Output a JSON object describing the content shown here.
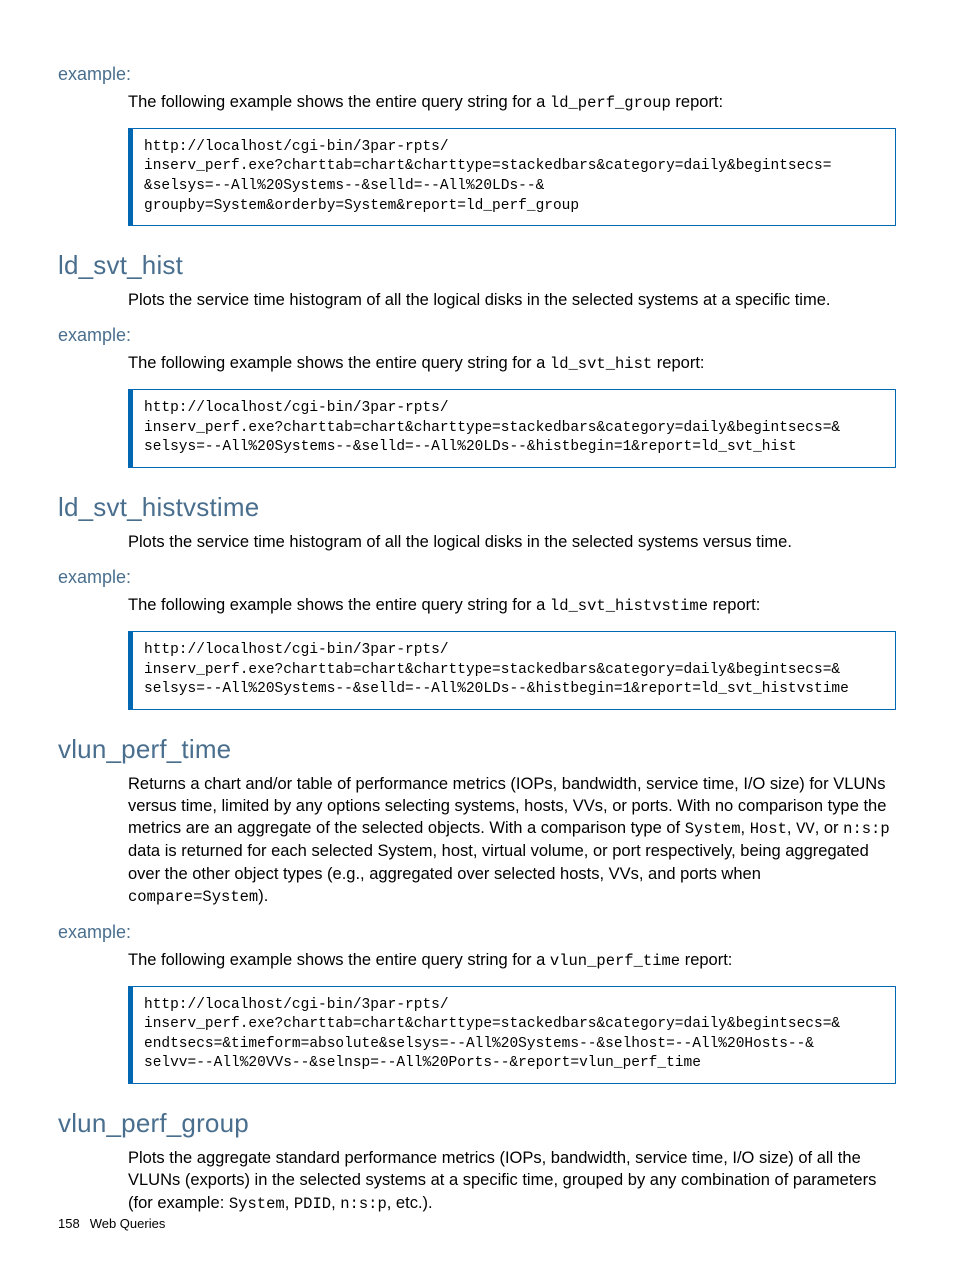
{
  "sections": [
    {
      "example_label": "example:",
      "intro_prefix": "The following example shows the entire query string for a ",
      "intro_code": "ld_perf_group",
      "intro_suffix": " report:",
      "code": "http://localhost/cgi-bin/3par-rpts/\ninserv_perf.exe?charttab=chart&charttype=stackedbars&category=daily&begintsecs=\n&selsys=--All%20Systems--&selld=--All%20LDs--&\ngroupby=System&orderby=System&report=ld_perf_group"
    },
    {
      "heading": "ld_svt_hist",
      "desc": "Plots the service time histogram of all the logical disks in the selected systems at a specific time.",
      "example_label": "example:",
      "intro_prefix": "The following example shows the entire query string for a ",
      "intro_code": "ld_svt_hist",
      "intro_suffix": " report:",
      "code": "http://localhost/cgi-bin/3par-rpts/\ninserv_perf.exe?charttab=chart&charttype=stackedbars&category=daily&begintsecs=&\nselsys=--All%20Systems--&selld=--All%20LDs--&histbegin=1&report=ld_svt_hist"
    },
    {
      "heading": "ld_svt_histvstime",
      "desc": "Plots the service time histogram of all the logical disks in the selected systems versus time.",
      "example_label": "example:",
      "intro_prefix": "The following example shows the entire query string for a ",
      "intro_code": "ld_svt_histvstime",
      "intro_suffix": " report:",
      "code": "http://localhost/cgi-bin/3par-rpts/\ninserv_perf.exe?charttab=chart&charttype=stackedbars&category=daily&begintsecs=&\nselsys=--All%20Systems--&selld=--All%20LDs--&histbegin=1&report=ld_svt_histvstime"
    },
    {
      "heading": "vlun_perf_time",
      "desc_parts": [
        {
          "t": "text",
          "v": "Returns a chart and/or table of performance metrics (IOPs, bandwidth, service time, I/O size) for VLUNs versus time, limited by any options selecting systems, hosts, VVs, or ports. With no comparison type the metrics are an aggregate of the selected objects. With a comparison type of "
        },
        {
          "t": "code",
          "v": "System"
        },
        {
          "t": "text",
          "v": ", "
        },
        {
          "t": "code",
          "v": "Host"
        },
        {
          "t": "text",
          "v": ", "
        },
        {
          "t": "code",
          "v": "VV"
        },
        {
          "t": "text",
          "v": ", or "
        },
        {
          "t": "code",
          "v": "n:s:p"
        },
        {
          "t": "text",
          "v": " data is returned for each selected System, host, virtual volume, or port respectively, being aggregated over the other object types (e.g., aggregated over selected hosts, VVs, and ports when "
        },
        {
          "t": "code",
          "v": "compare=System"
        },
        {
          "t": "text",
          "v": ")."
        }
      ],
      "example_label": "example:",
      "intro_prefix": "The following example shows the entire query string for a ",
      "intro_code": "vlun_perf_time",
      "intro_suffix": " report:",
      "code": "http://localhost/cgi-bin/3par-rpts/\ninserv_perf.exe?charttab=chart&charttype=stackedbars&category=daily&begintsecs=&\nendtsecs=&timeform=absolute&selsys=--All%20Systems--&selhost=--All%20Hosts--&\nselvv=--All%20VVs--&selnsp=--All%20Ports--&report=vlun_perf_time"
    },
    {
      "heading": "vlun_perf_group",
      "desc_parts": [
        {
          "t": "text",
          "v": "Plots the aggregate standard performance metrics (IOPs, bandwidth, service time, I/O size) of all the VLUNs (exports) in the selected systems at a specific time, grouped by any combination of parameters (for example: "
        },
        {
          "t": "code",
          "v": "System"
        },
        {
          "t": "text",
          "v": ", "
        },
        {
          "t": "code",
          "v": "PDID"
        },
        {
          "t": "text",
          "v": ", "
        },
        {
          "t": "code",
          "v": "n:s:p"
        },
        {
          "t": "text",
          "v": ", etc.)."
        }
      ]
    }
  ],
  "footer": {
    "page": "158",
    "title": "Web Queries"
  }
}
